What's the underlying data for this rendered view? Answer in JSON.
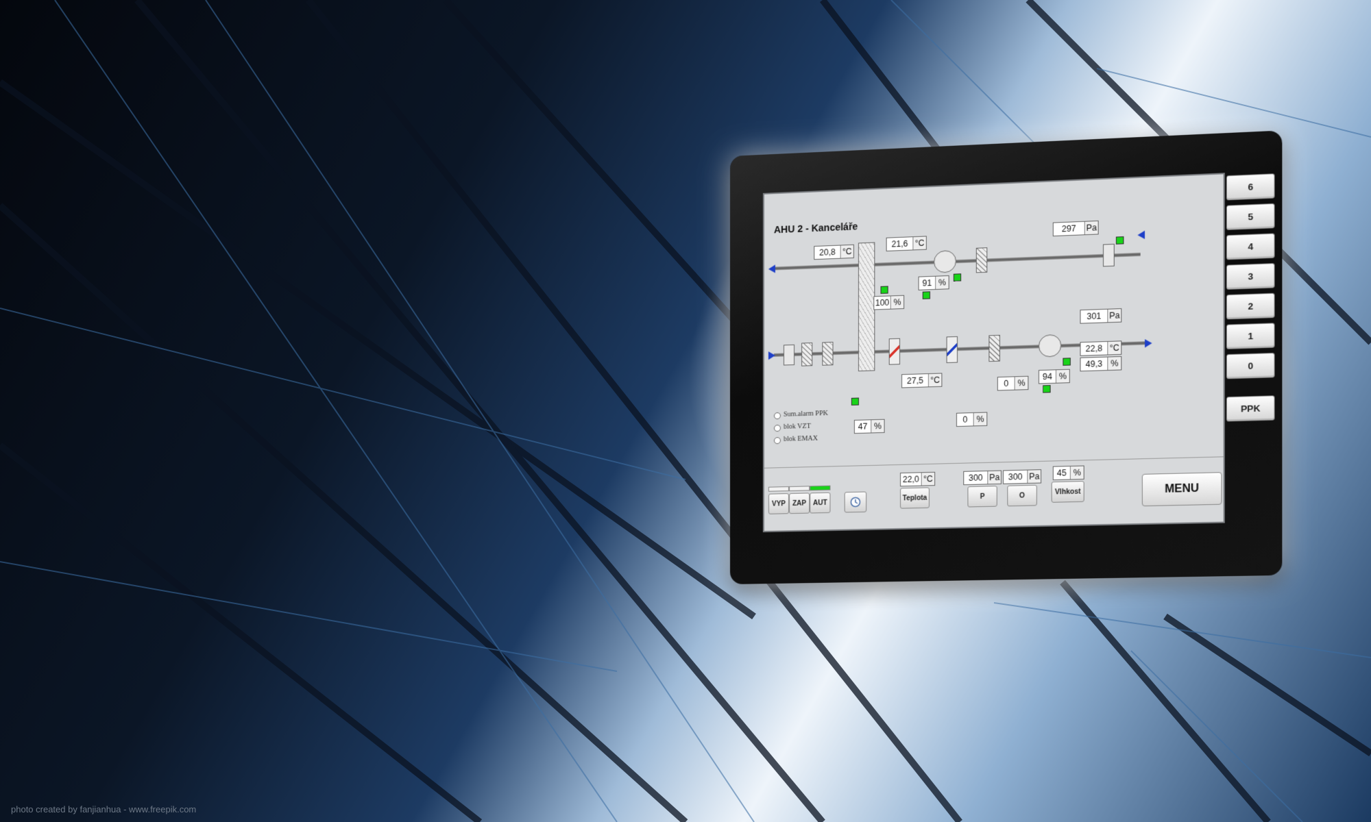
{
  "background": {
    "credit": "photo created by fanjianhua - www.freepik.com",
    "colors": {
      "accent": "#19d319",
      "duct_arrow": "#1e3fc8",
      "heater": "#d9342b"
    }
  },
  "hmi": {
    "title": "AHU 2 - Kanceláře",
    "readings": {
      "t_exhaust": {
        "value": "20,8",
        "unit": "°C"
      },
      "t_extract": {
        "value": "21,6",
        "unit": "°C"
      },
      "p_exhaust": {
        "value": "297",
        "unit": "Pa"
      },
      "fan_extract_speed": {
        "value": "91",
        "unit": "%"
      },
      "recovery": {
        "value": "100",
        "unit": "%"
      },
      "p_supply": {
        "value": "301",
        "unit": "Pa"
      },
      "t_supply": {
        "value": "22,8",
        "unit": "°C"
      },
      "rh_supply": {
        "value": "49,3",
        "unit": "%"
      },
      "fan_supply_speed": {
        "value": "94",
        "unit": "%"
      },
      "cooler_valve": {
        "value": "0",
        "unit": "%"
      },
      "cooler_valve2": {
        "value": "0",
        "unit": "%"
      },
      "t_heater": {
        "value": "27,5",
        "unit": "°C"
      },
      "heater_valve": {
        "value": "47",
        "unit": "%"
      }
    },
    "alarms": [
      "Sum.alarm PPK",
      "blok VZT",
      "blok EMAX"
    ],
    "modes": {
      "off": "VYP",
      "on": "ZAP",
      "auto": "AUT"
    },
    "setpoints": {
      "temperature": {
        "value": "22,0",
        "unit": "°C",
        "button": "Teplota"
      },
      "pressure_p": {
        "value": "300",
        "unit": "Pa",
        "button": "P"
      },
      "pressure_o": {
        "value": "300",
        "unit": "Pa",
        "button": "O"
      },
      "humidity": {
        "value": "45",
        "unit": "%",
        "button": "Vlhkost"
      }
    },
    "menu": "MENU",
    "side_buttons": [
      "6",
      "5",
      "4",
      "3",
      "2",
      "1",
      "0"
    ],
    "ppk": "PPK",
    "clock_icon": "clock-icon"
  }
}
